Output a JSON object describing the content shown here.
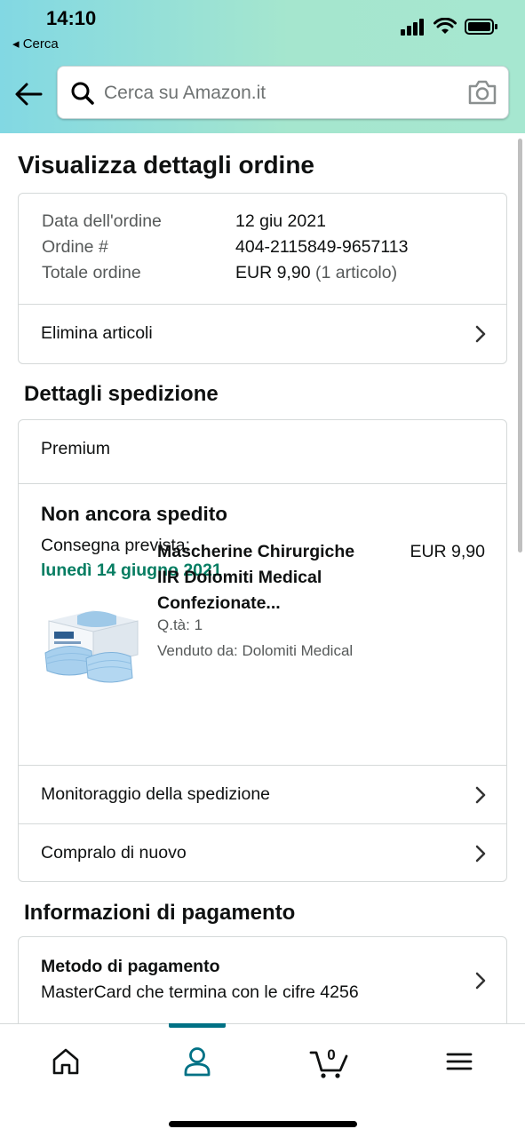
{
  "status_bar": {
    "time": "14:10",
    "back_label": "◂ Cerca"
  },
  "search": {
    "placeholder": "Cerca su Amazon.it"
  },
  "page": {
    "title": "Visualizza dettagli ordine"
  },
  "order_summary": {
    "rows": [
      {
        "label": "Data dell'ordine",
        "value": "12 giu 2021"
      },
      {
        "label": "Ordine #",
        "value": "404-2115849-9657113"
      },
      {
        "label": "Totale ordine",
        "value": "EUR 9,90",
        "extra": "(1 articolo)"
      }
    ],
    "remove_items_label": "Elimina articoli"
  },
  "shipping": {
    "section_title": "Dettagli spedizione",
    "shipping_type": "Premium",
    "status": "Non ancora spedito",
    "delivery_label": "Consegna prevista:",
    "delivery_date": "lunedì 14 giugno 2021",
    "product": {
      "name": "Mascherine Chirurgiche IIR Dolomiti Medical Confezionate...",
      "price": "EUR 9,90",
      "quantity": "Q.tà: 1",
      "seller": "Venduto da: Dolomiti Medical"
    },
    "tracking_label": "Monitoraggio della spedizione",
    "buy_again_label": "Compralo di nuovo"
  },
  "payment": {
    "section_title": "Informazioni di pagamento",
    "method_title": "Metodo di pagamento",
    "method_detail": "MasterCard che termina con le cifre 4256"
  },
  "bottom_nav": {
    "items": [
      "home-icon",
      "account-icon",
      "cart-icon",
      "menu-icon"
    ],
    "active": "account-icon",
    "cart_count": "0"
  },
  "colors": {
    "accent": "#007185",
    "delivery_green": "#067d62",
    "header_gradient_start": "#82d8e3",
    "header_gradient_end": "#a6e7d0"
  }
}
